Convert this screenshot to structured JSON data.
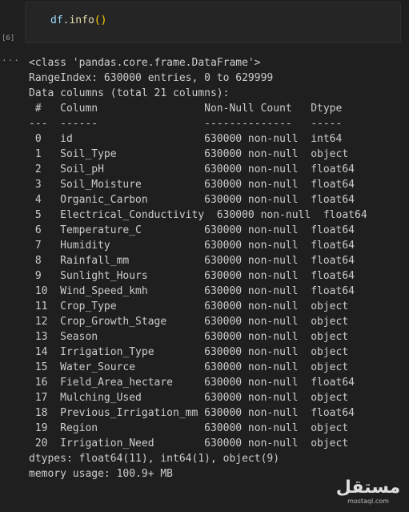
{
  "cell": {
    "execution_count": "[6]",
    "code": {
      "var": "df",
      "dot": ".",
      "fn": "info",
      "parens": "()"
    }
  },
  "output": {
    "gutter": "...",
    "lines": [
      "<class 'pandas.core.frame.DataFrame'>",
      "RangeIndex: 630000 entries, 0 to 629999",
      "Data columns (total 21 columns):",
      " #   Column                 Non-Null Count   Dtype  ",
      "---  ------                 --------------   -----  ",
      " 0   id                     630000 non-null  int64  ",
      " 1   Soil_Type              630000 non-null  object ",
      " 2   Soil_pH                630000 non-null  float64",
      " 3   Soil_Moisture          630000 non-null  float64",
      " 4   Organic_Carbon         630000 non-null  float64",
      " 5   Electrical_Conductivity  630000 non-null  float64",
      " 6   Temperature_C          630000 non-null  float64",
      " 7   Humidity               630000 non-null  float64",
      " 8   Rainfall_mm            630000 non-null  float64",
      " 9   Sunlight_Hours         630000 non-null  float64",
      " 10  Wind_Speed_kmh         630000 non-null  float64",
      " 11  Crop_Type              630000 non-null  object ",
      " 12  Crop_Growth_Stage      630000 non-null  object ",
      " 13  Season                 630000 non-null  object ",
      " 14  Irrigation_Type        630000 non-null  object ",
      " 15  Water_Source           630000 non-null  object ",
      " 16  Field_Area_hectare     630000 non-null  float64",
      " 17  Mulching_Used          630000 non-null  object ",
      " 18  Previous_Irrigation_mm 630000 non-null  float64",
      " 19  Region                 630000 non-null  object ",
      " 20  Irrigation_Need        630000 non-null  object ",
      "dtypes: float64(11), int64(1), object(9)",
      "memory usage: 100.9+ MB"
    ]
  },
  "watermark": {
    "logo": "مستقل",
    "sub": "mostaql.com"
  }
}
